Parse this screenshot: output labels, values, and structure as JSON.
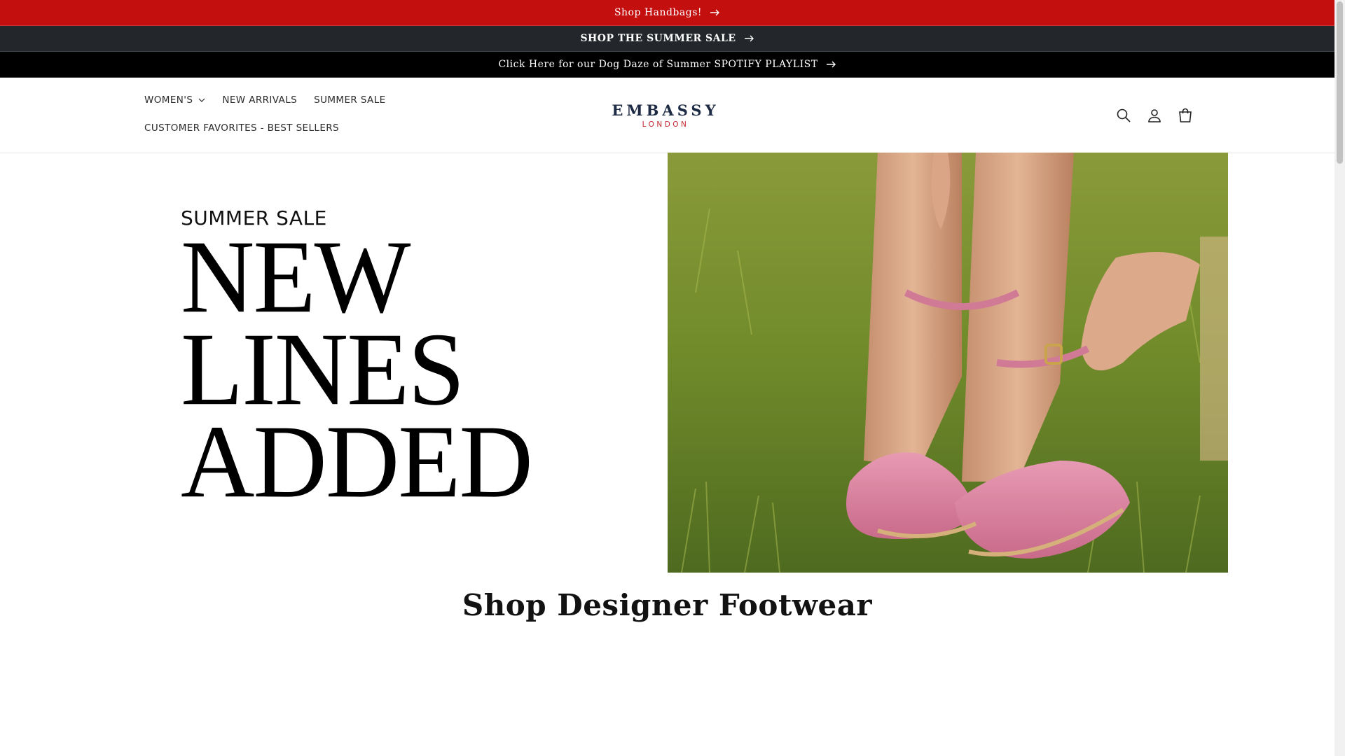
{
  "announcements": [
    {
      "text": "Shop Handbags!",
      "bg": "#c40f0f"
    },
    {
      "text": "SHOP THE SUMMER SALE",
      "bg": "#23272b"
    },
    {
      "text": "Click Here for our Dog Daze of Summer SPOTIFY PLAYLIST",
      "bg": "#000000"
    }
  ],
  "nav": {
    "items": [
      {
        "label": "WOMEN'S",
        "has_dropdown": true
      },
      {
        "label": "NEW ARRIVALS"
      },
      {
        "label": "SUMMER SALE"
      },
      {
        "label": "CUSTOMER FAVORITES - BEST SELLERS"
      }
    ]
  },
  "logo": {
    "main": "EMBASSY",
    "sub": "LONDON",
    "main_color": "#1c2a44",
    "sub_color": "#c3272e"
  },
  "header_icons": [
    "search-icon",
    "account-icon",
    "cart-icon"
  ],
  "hero": {
    "kicker": "SUMMER SALE",
    "lines": [
      "NEW",
      "LINES",
      "ADDED"
    ],
    "image_icon": "pink-shoes-on-grass-photo"
  },
  "section": {
    "title": "Shop Designer Footwear"
  }
}
